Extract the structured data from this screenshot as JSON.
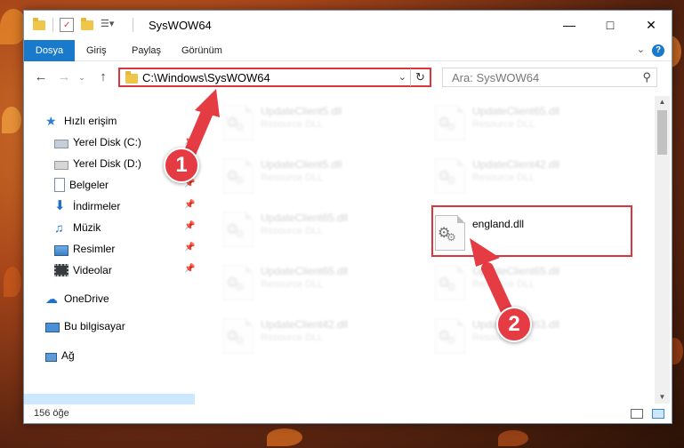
{
  "window": {
    "title": "SysWOW64"
  },
  "ribbon": {
    "tabs": [
      "Dosya",
      "Giriş",
      "Paylaş",
      "Görünüm"
    ]
  },
  "address": {
    "path": "C:\\Windows\\SysWOW64"
  },
  "search": {
    "placeholder": "Ara: SysWOW64"
  },
  "nav": {
    "quick_access": "Hızlı erişim",
    "items": [
      "Yerel Disk (C:)",
      "Yerel Disk (D:)",
      "Belgeler",
      "İndirmeler",
      "Müzik",
      "Resimler",
      "Videolar"
    ],
    "onedrive": "OneDrive",
    "this_pc": "Bu bilgisayar",
    "network": "Ağ"
  },
  "files": {
    "left": [
      {
        "name": "UpdateClient5.dll",
        "type": "Resource DLL"
      },
      {
        "name": "UpdateClient5.dll",
        "type": "Resource DLL"
      },
      {
        "name": "UpdateClient65.dll",
        "type": "Resource DLL"
      },
      {
        "name": "UpdateClient65.dll",
        "type": "Resource DLL"
      },
      {
        "name": "UpdateClient42.dll",
        "type": "Resource DLL"
      }
    ],
    "right": [
      {
        "name": "UpdateClient65.dll",
        "type": "Resource DLL"
      },
      {
        "name": "UpdateClient42.dll",
        "type": "Resource DLL"
      },
      {
        "name": "england.dll",
        "type": ""
      },
      {
        "name": "UpdateClient65.dll",
        "type": "Resource DLL"
      },
      {
        "name": "UpdateClient63.dll",
        "type": "Resource DLL"
      }
    ]
  },
  "status": {
    "count": "156 öğe"
  },
  "annotations": {
    "one": "1",
    "two": "2"
  },
  "colors": {
    "accent": "#1979ca",
    "highlight": "#d9363e",
    "selected": "#cce8ff"
  }
}
